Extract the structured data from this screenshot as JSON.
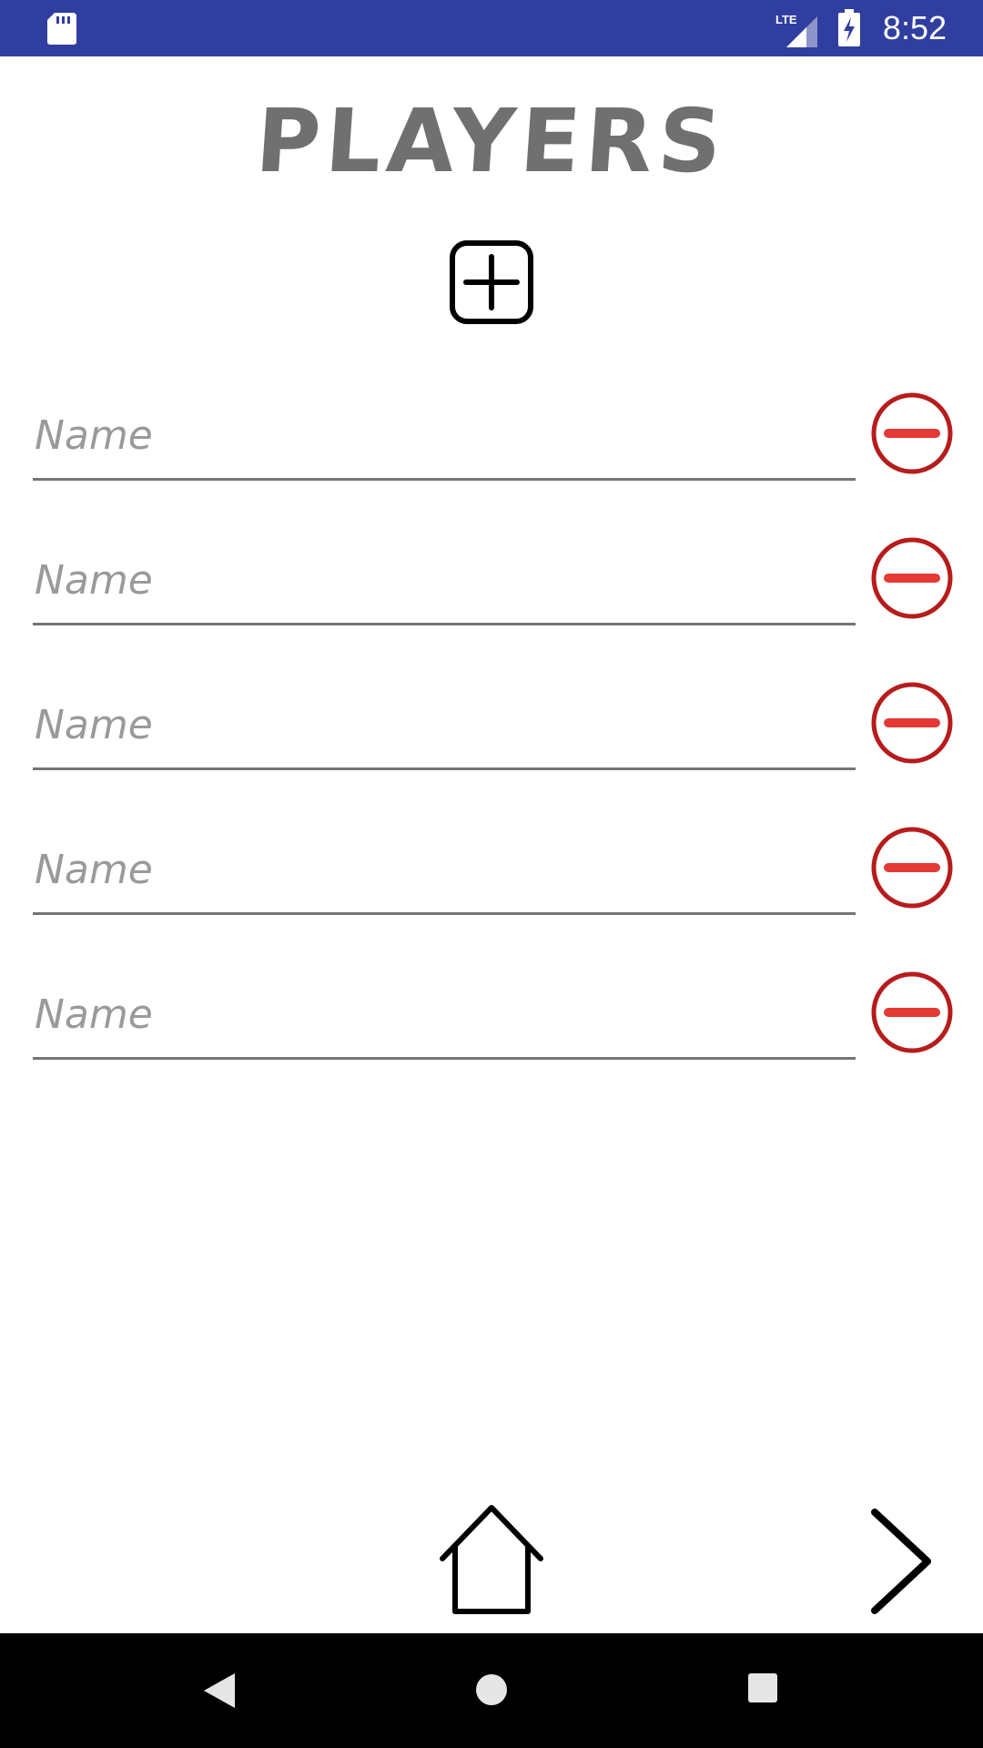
{
  "status_bar": {
    "time": "8:52",
    "network_label": "LTE",
    "icons": [
      "sd-card-icon",
      "lte-signal-icon",
      "battery-charging-icon"
    ],
    "color": "#303F9F"
  },
  "title": "PLAYERS",
  "add_button": {
    "icon": "add-square-icon"
  },
  "players": [
    {
      "value": "",
      "placeholder": "Name"
    },
    {
      "value": "",
      "placeholder": "Name"
    },
    {
      "value": "",
      "placeholder": "Name"
    },
    {
      "value": "",
      "placeholder": "Name"
    },
    {
      "value": "",
      "placeholder": "Name"
    }
  ],
  "remove_button": {
    "icon": "remove-circle-icon",
    "ring_color": "#B71C1C",
    "bar_color": "#E53935"
  },
  "bottom_nav": {
    "home_icon": "home-outline-icon",
    "next_icon": "chevron-right-icon"
  },
  "system_nav": {
    "icons": [
      "back-triangle-icon",
      "home-circle-icon",
      "recents-square-icon"
    ]
  }
}
